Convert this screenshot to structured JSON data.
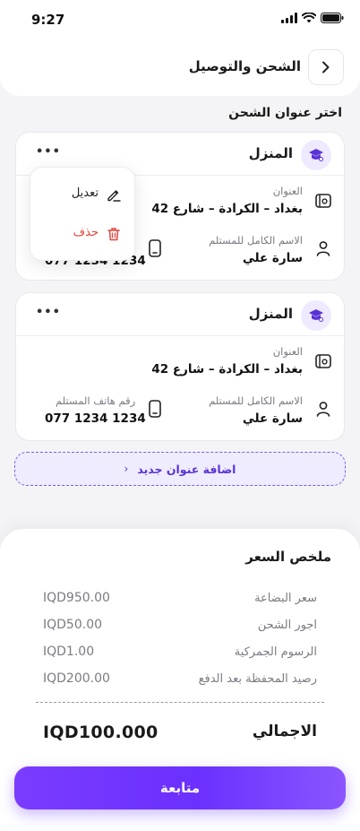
{
  "status_bar": {
    "time": "9:27"
  },
  "header": {
    "title": "الشحن والتوصيل"
  },
  "section": {
    "title": "اختر عنوان الشحن"
  },
  "addresses": [
    {
      "name": "المنزل",
      "address_label": "العنوان",
      "address": "بغداد – الكرادة – شارع 42",
      "recipient_label": "الاسم الكامل للمستلم",
      "recipient": "سارة علي",
      "phone_value_partial": "077 1234 1234"
    },
    {
      "name": "المنزل",
      "address_label": "العنوان",
      "address": "بغداد – الكرادة – شارع 42",
      "recipient_label": "الاسم الكامل للمستلم",
      "recipient": "سارة علي",
      "phone_label": "رقم هاتف المستلم",
      "phone": "077 1234 1234"
    }
  ],
  "menu": {
    "edit": "تعديل",
    "delete": "حذف"
  },
  "add_address": {
    "label": "اضافة عنوان جديد",
    "chevron": "‹"
  },
  "summary": {
    "title": "ملخص السعر",
    "rows": [
      {
        "label": "سعر البضاعة",
        "value": "IQD950.00"
      },
      {
        "label": "اجور الشحن",
        "value": "IQD50.00"
      },
      {
        "label": "الرسوم الجمركية",
        "value": "IQD1.00"
      },
      {
        "label": "رصيد المحفظة بعد الدفع",
        "value": "IQD200.00"
      }
    ],
    "total_label": "الاجمالي",
    "total_value": "IQD100.000"
  },
  "cta": {
    "label": "متابعة"
  },
  "colors": {
    "accent": "#6b2fff",
    "delete": "#e0463c",
    "background": "#f4f4f6"
  }
}
